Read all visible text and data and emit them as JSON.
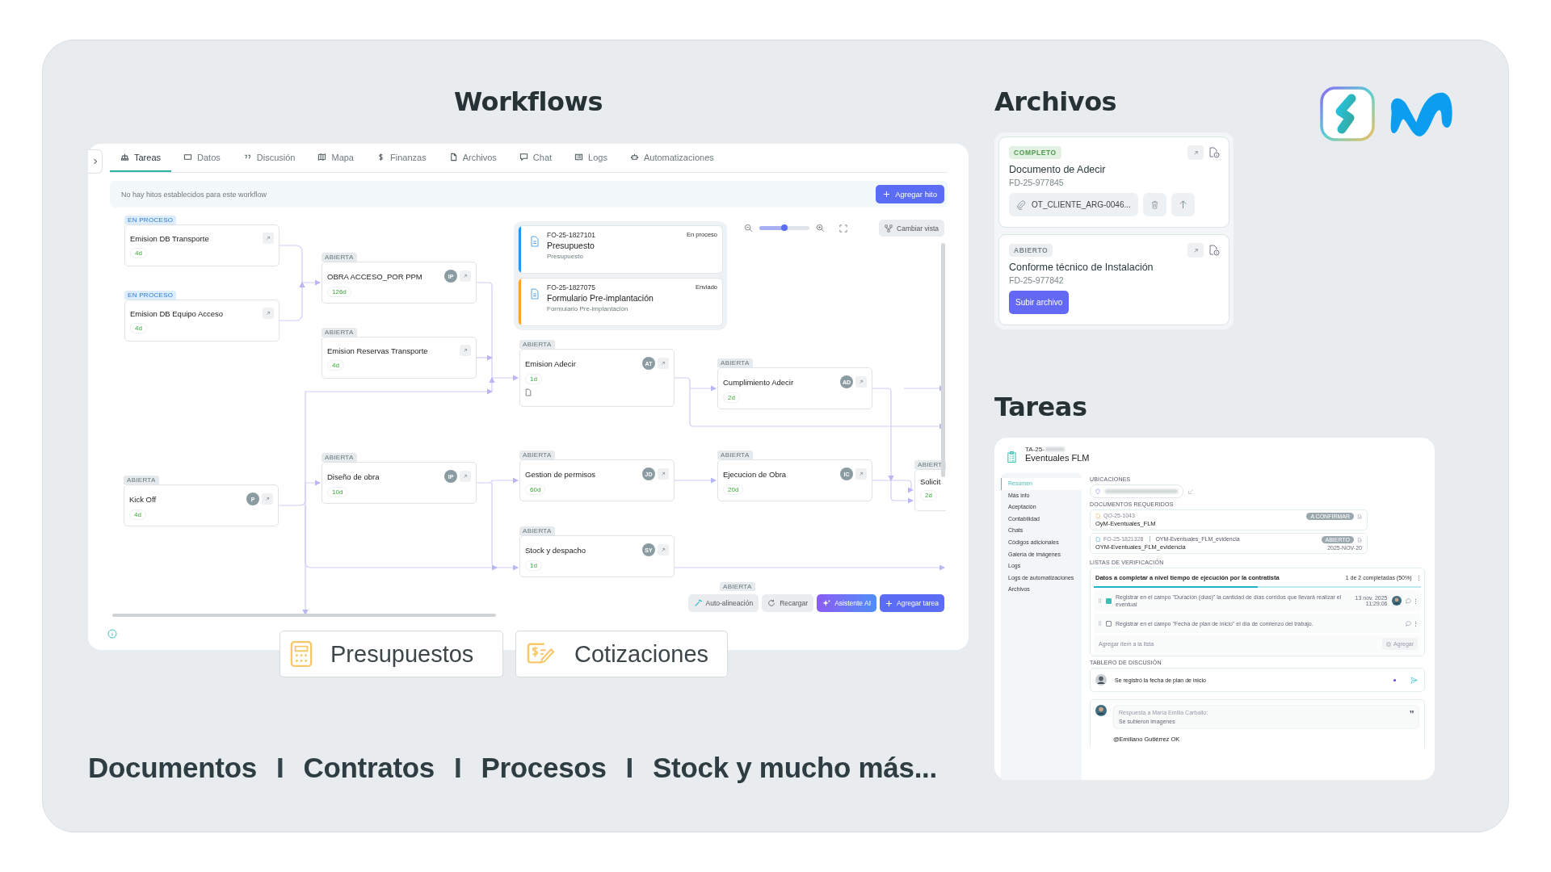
{
  "headings": {
    "workflows": "Workflows",
    "archivos": "Archivos",
    "tareas": "Tareas"
  },
  "workflow": {
    "tabs": [
      {
        "label": "Tareas",
        "selected": true
      },
      {
        "label": "Datos",
        "selected": false
      },
      {
        "label": "Discusión",
        "selected": false
      },
      {
        "label": "Mapa",
        "selected": false
      },
      {
        "label": "Finanzas",
        "selected": false
      },
      {
        "label": "Archivos",
        "selected": false
      },
      {
        "label": "Chat",
        "selected": false
      },
      {
        "label": "Logs",
        "selected": false
      },
      {
        "label": "Automatizaciones",
        "selected": false
      }
    ],
    "banner": {
      "text": "No hay hitos establecidos para este workflow",
      "button": "Agregar hito"
    },
    "nodes": [
      {
        "kind": "in_progress",
        "status": "EN PROCESO",
        "title": "Emision DB Transporte",
        "duration": "4d"
      },
      {
        "kind": "in_progress",
        "status": "EN PROCESO",
        "title": "Emision DB Equipo Acceso",
        "duration": "4d"
      },
      {
        "kind": "open",
        "status": "ABIERTA",
        "title": "OBRA ACCESO_POR PPM",
        "duration": "126d",
        "initials": "IP"
      },
      {
        "kind": "open",
        "status": "ABIERTA",
        "title": "Emision Reservas Transporte",
        "duration": "4d"
      },
      {
        "kind": "open",
        "status": "ABIERTA",
        "title": "Emision Adecir",
        "duration": "1d",
        "initials": "AT",
        "has_document": true
      },
      {
        "kind": "open",
        "status": "ABIERTA",
        "title": "Cumplimiento Adecir",
        "duration": "2d",
        "initials": "AD"
      },
      {
        "kind": "open",
        "status": "ABIERTA",
        "title": "Kick Off",
        "duration": "4d",
        "initials": "P"
      },
      {
        "kind": "open",
        "status": "ABIERTA",
        "title": "Diseño de obra",
        "duration": "10d",
        "initials": "IP"
      },
      {
        "kind": "open",
        "status": "ABIERTA",
        "title": "Gestion de permisos",
        "duration": "60d",
        "initials": "JD"
      },
      {
        "kind": "open",
        "status": "ABIERTA",
        "title": "Ejecucion de Obra",
        "duration": "20d",
        "initials": "IC"
      },
      {
        "kind": "open",
        "status": "ABIERTA",
        "title": "Stock y despacho",
        "duration": "1d",
        "initials": "SY"
      },
      {
        "kind": "open",
        "status": "ABIERT",
        "title": "Solicit",
        "duration": "2d"
      },
      {
        "kind": "open",
        "status": "ABIERTA"
      }
    ],
    "documents": [
      {
        "code": "FO-25-1827101",
        "state": "En proceso",
        "name": "Presupuesto",
        "subtitle": "Presupuesto",
        "color": "#2196f3"
      },
      {
        "code": "FO-25-1827075",
        "state": "Enviado",
        "name": "Formulario Pre-implantación",
        "subtitle": "Formulario Pre-implantación",
        "color": "#f5a623"
      }
    ],
    "zoom": {
      "level": 0.5
    },
    "view_button": "Cambiar vista",
    "toolbar": [
      {
        "kind": "align",
        "label": "Auto-alineación"
      },
      {
        "kind": "reload",
        "label": "Recargar"
      },
      {
        "kind": "ai",
        "label": "Asistente AI"
      },
      {
        "kind": "add",
        "label": "Agregar tarea"
      }
    ]
  },
  "features": [
    {
      "kind": "calculator",
      "label": "Presupuestos"
    },
    {
      "kind": "quote",
      "label": "Cotizaciones"
    }
  ],
  "tagline": [
    {
      "kind": "word",
      "text": "Documentos"
    },
    {
      "kind": "separator",
      "text": "I"
    },
    {
      "kind": "word",
      "text": "Contratos"
    },
    {
      "kind": "separator",
      "text": "I"
    },
    {
      "kind": "word",
      "text": "Procesos"
    },
    {
      "kind": "separator",
      "text": "I"
    },
    {
      "kind": "word",
      "text": "Stock y mucho más..."
    }
  ],
  "archivos": [
    {
      "kind": "complete",
      "status": "COMPLETO",
      "title": "Documento de Adecir",
      "code": "FD-25-977845",
      "attachment": "OT_CLIENTE_ARG-0046..."
    },
    {
      "kind": "open",
      "status": "ABIERTO",
      "title": "Conforme técnico de Instalación",
      "code": "FD-25-977842",
      "button": "Subir archivo"
    }
  ],
  "tareas": {
    "code": "TA-25-",
    "title": "Eventuales FLM",
    "menu": [
      {
        "label": "Resumen",
        "selected": true
      },
      {
        "label": "Más info",
        "selected": false
      },
      {
        "label": "Aceptación",
        "selected": false
      },
      {
        "label": "Contabilidad",
        "selected": false
      },
      {
        "label": "Chats",
        "selected": false
      },
      {
        "label": "Códigos adicionales",
        "selected": false
      },
      {
        "label": "Galería de imágenes",
        "selected": false
      },
      {
        "label": "Logs",
        "selected": false
      },
      {
        "label": "Logs de automatizaciones",
        "selected": false
      },
      {
        "label": "Archivos",
        "selected": false
      }
    ],
    "sections": {
      "locations": "UBICACIONES",
      "documents": "DOCUMENTOS REQUERIDOS",
      "checklists": "LISTAS DE VERIFICACIÓN",
      "discussion": "TABLERO DE DISCUSIÓN"
    },
    "documents": [
      {
        "kind": "quote",
        "code": "QO-25-1043",
        "name": "OyM-Eventuales_FLM",
        "status": "A CONFIRMAR"
      },
      {
        "kind": "form",
        "code": "FO-25-1821328",
        "form": "OYM-Eventuales_FLM_evidencia",
        "name": "OYM-Eventuales_FLM_evidencia",
        "status": "ABIERTO",
        "date": "2025-NOV-20"
      }
    ],
    "checklist": {
      "title": "Datos a completar a nivel tiempo de ejecución por la contratista",
      "progress": "1 de 2 completadas (50%)",
      "level": 0.5,
      "items": [
        {
          "text": "Registrar en el campo \"Duración (días)\" la cantidad de días corridos que llevará realizar el eventual",
          "checked": true,
          "date": "13 nov. 2025",
          "time": "11:29:06"
        },
        {
          "text": "Registrar en el campo \"Fecha de plan de inicio\" el día de comienzo del trabajo.",
          "checked": false
        }
      ],
      "add_placeholder": "Agregar ítem a la lista",
      "add_button": "Agregar"
    },
    "comment": {
      "value": "Se registró la fecha de plan de inicio"
    },
    "reply": {
      "quote_author": "Respuesta a María Emilia Carballo:",
      "quote_text": "Se subieron imagenes",
      "text": "@Emiliano Gutiérrez OK"
    }
  }
}
